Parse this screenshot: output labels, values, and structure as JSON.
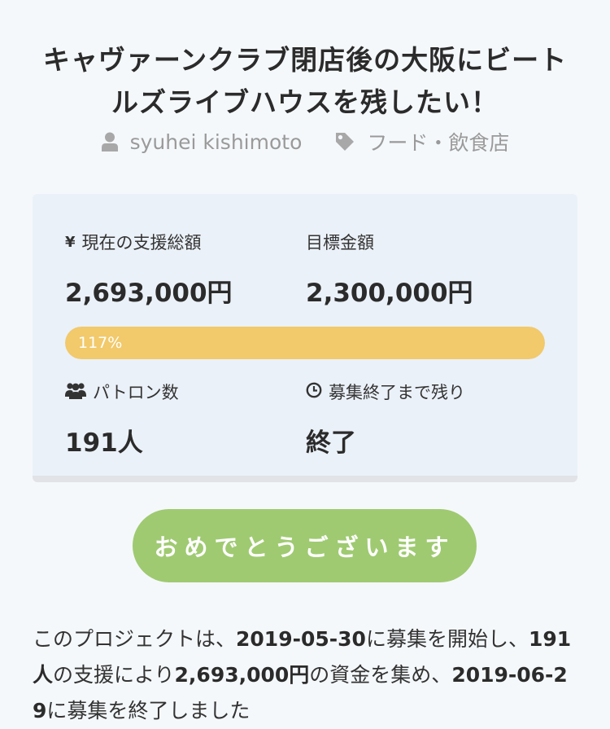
{
  "project": {
    "title": "キャヴァーンクラブ閉店後の大阪にビートルズライブハウスを残したい！",
    "owner": "syuhei kishimoto",
    "category": "フード・飲食店"
  },
  "stats": {
    "current_label": "現在の支援総額",
    "current_value": "2,693,000円",
    "goal_label": "目標金額",
    "goal_value": "2,300,000円",
    "progress_text": "117%",
    "progress_fraction": 1.17,
    "patrons_label": "パトロン数",
    "patrons_value": "191人",
    "remaining_label": "募集終了まで残り",
    "remaining_value": "終了",
    "currency_symbol": "¥"
  },
  "cta": {
    "label": "おめでとうございます"
  },
  "summary": {
    "t1": "このプロジェクトは、",
    "start_date": "2019-05-30",
    "t2": "に募集を開始し、",
    "patrons": "191人",
    "t3": "の支援により",
    "amount": "2,693,000円",
    "t4": "の資金を集め、",
    "end_date": "2019-06-29",
    "t5": "に募集を終了しました"
  },
  "icons": {
    "owner": "user-icon",
    "category": "tag-icon",
    "current": "yen-icon",
    "patrons": "group-icon",
    "remaining": "clock-icon"
  },
  "colors": {
    "progress": "#f2c96b",
    "cta": "#9fca71",
    "card": "#ebf1f8"
  }
}
